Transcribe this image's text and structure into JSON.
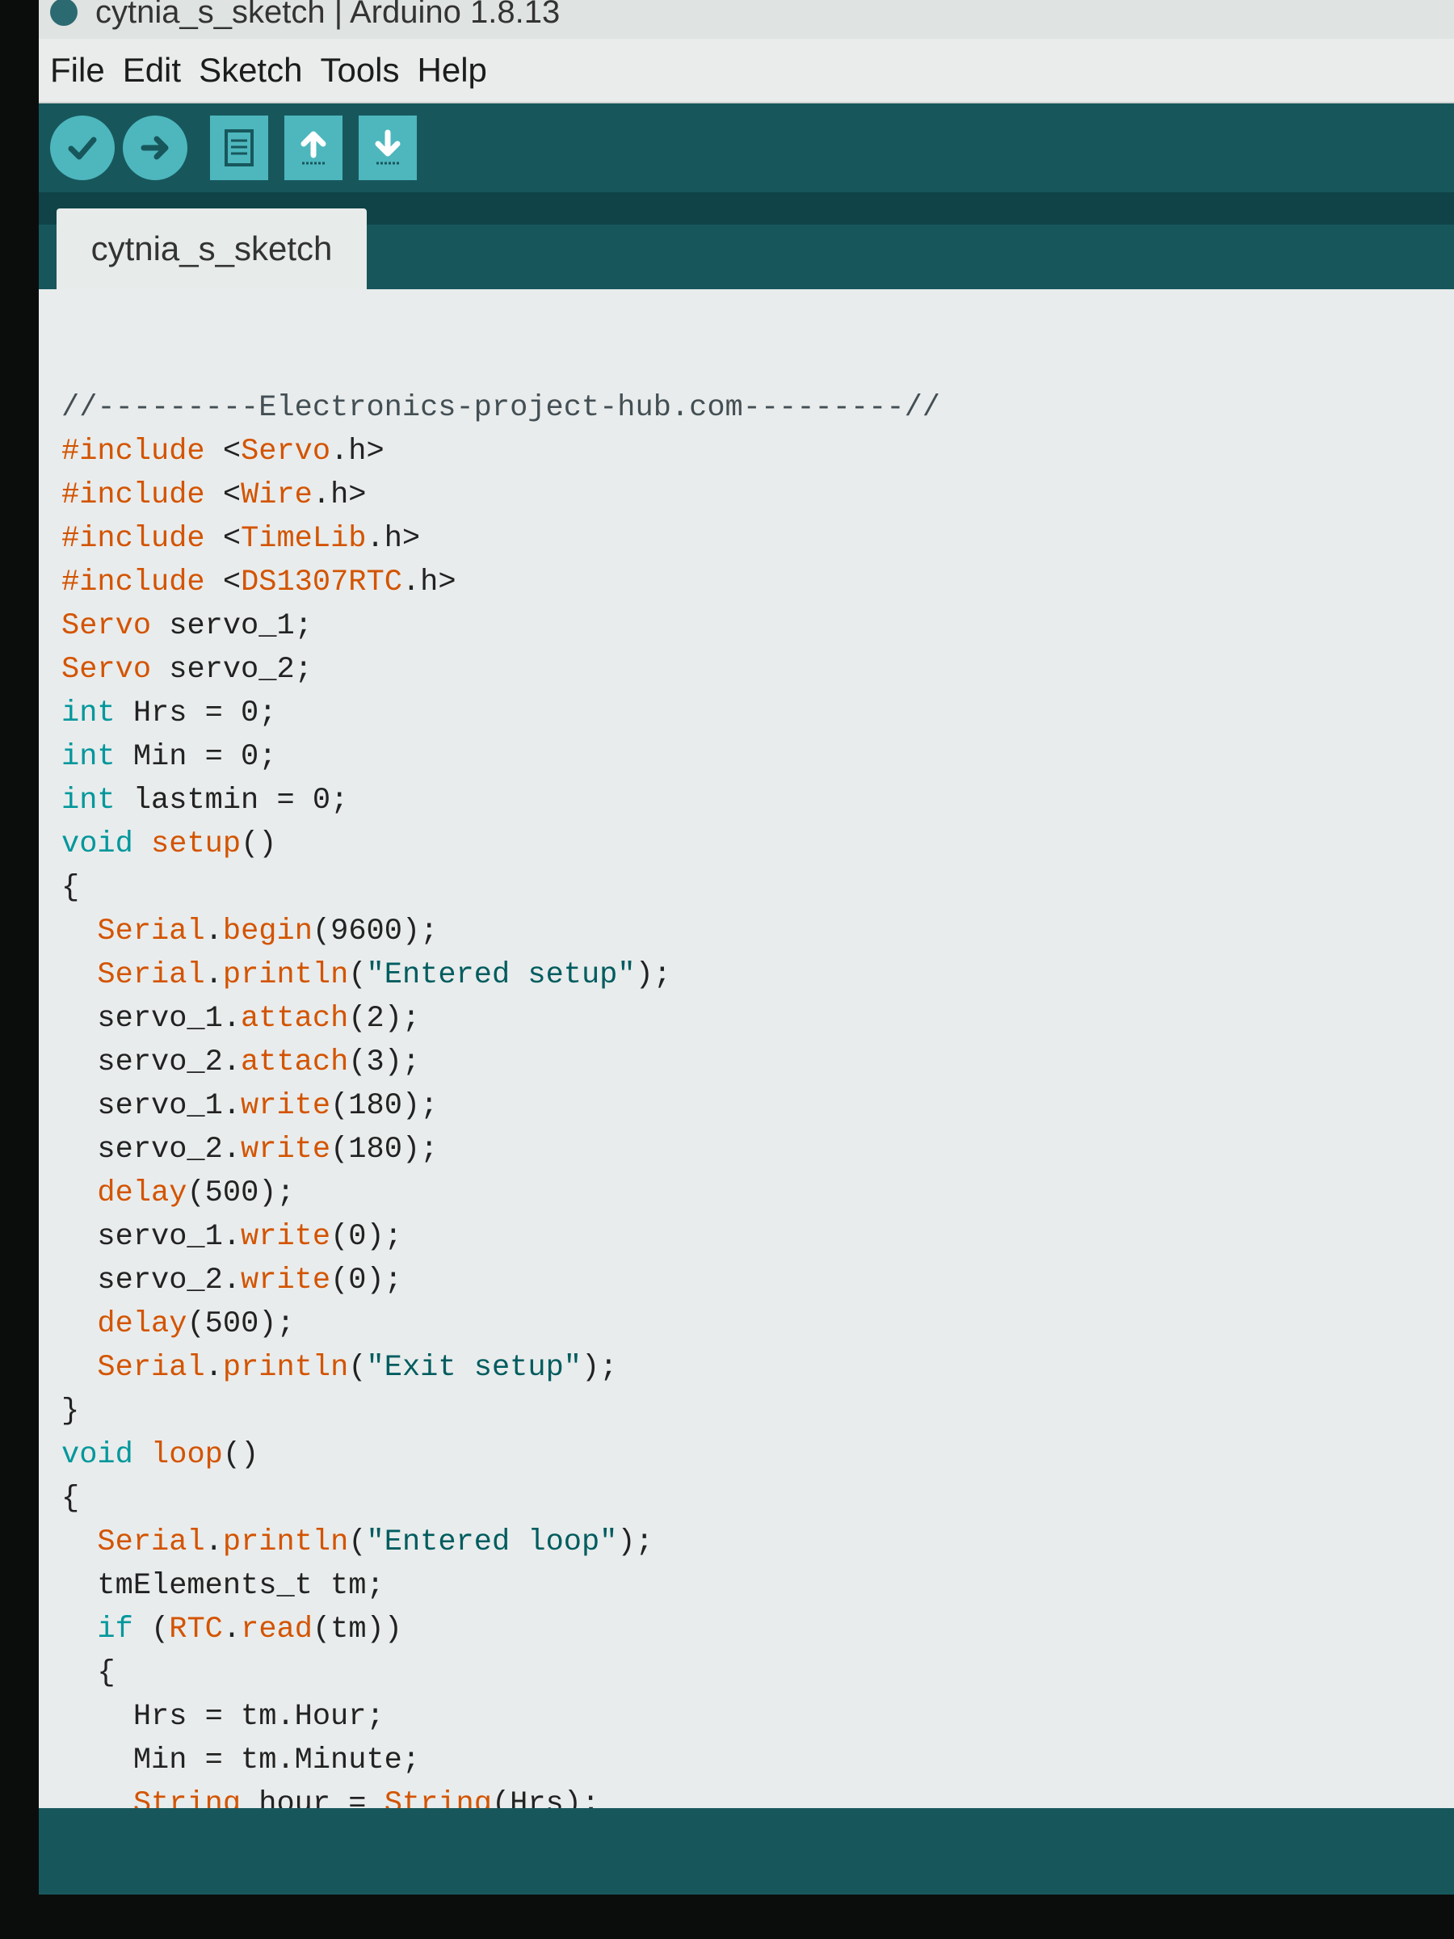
{
  "window": {
    "title": "cytnia_s_sketch | Arduino 1.8.13"
  },
  "menu": [
    "File",
    "Edit",
    "Sketch",
    "Tools",
    "Help"
  ],
  "toolbar": {
    "buttons": [
      {
        "name": "verify",
        "icon": "checkmark-icon"
      },
      {
        "name": "upload",
        "icon": "arrow-right-icon"
      },
      {
        "name": "new",
        "icon": "new-file-icon"
      },
      {
        "name": "open",
        "icon": "arrow-up-icon"
      },
      {
        "name": "save",
        "icon": "arrow-down-icon"
      }
    ]
  },
  "tab": {
    "label": "cytnia_s_sketch"
  },
  "code": [
    "//---------Electronics-project-hub.com---------//",
    "#include <Servo.h>",
    "#include <Wire.h>",
    "#include <TimeLib.h>",
    "#include <DS1307RTC.h>",
    "Servo servo_1;",
    "Servo servo_2;",
    "int Hrs = 0;",
    "int Min = 0;",
    "int lastmin = 0;",
    "void setup()",
    "{",
    "  Serial.begin(9600);",
    "  Serial.println(\"Entered setup\");",
    "  servo_1.attach(2);",
    "  servo_2.attach(3);",
    "  servo_1.write(180);",
    "  servo_2.write(180);",
    "  delay(500);",
    "  servo_1.write(0);",
    "  servo_2.write(0);",
    "  delay(500);",
    "  Serial.println(\"Exit setup\");",
    "}",
    "void loop()",
    "{",
    "  Serial.println(\"Entered loop\");",
    "  tmElements_t tm;",
    "  if (RTC.read(tm))",
    "  {",
    "    Hrs = tm.Hour;",
    "    Min = tm.Minute;",
    "    String hour = String(Hrs);"
  ],
  "colors": {
    "toolbar_bg": "#17575c",
    "button_bg": "#4db7bd",
    "keyword": "#d35400",
    "type": "#00979c",
    "editor_bg": "#e9ecec"
  }
}
